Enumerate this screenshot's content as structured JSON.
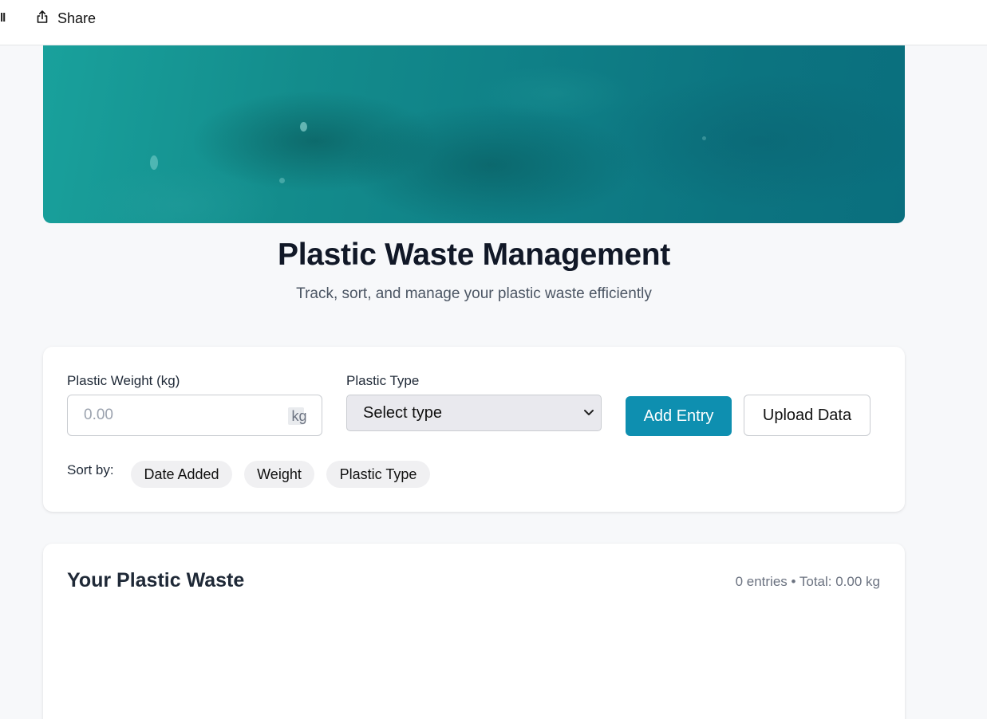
{
  "toolbar": {
    "edge_glyph": "ll",
    "share_label": "Share"
  },
  "header": {
    "title": "Plastic Waste Management",
    "subtitle": "Track, sort, and manage your plastic waste efficiently"
  },
  "form": {
    "weight_label": "Plastic Weight (kg)",
    "weight_placeholder": "0.00",
    "weight_unit": "kg",
    "type_label": "Plastic Type",
    "type_selected": "Select type",
    "add_button": "Add Entry",
    "upload_button": "Upload Data",
    "sort_label": "Sort by:",
    "sort_options": [
      "Date Added",
      "Weight",
      "Plastic Type"
    ]
  },
  "list": {
    "title": "Your Plastic Waste",
    "summary": "0 entries • Total: 0.00 kg"
  }
}
